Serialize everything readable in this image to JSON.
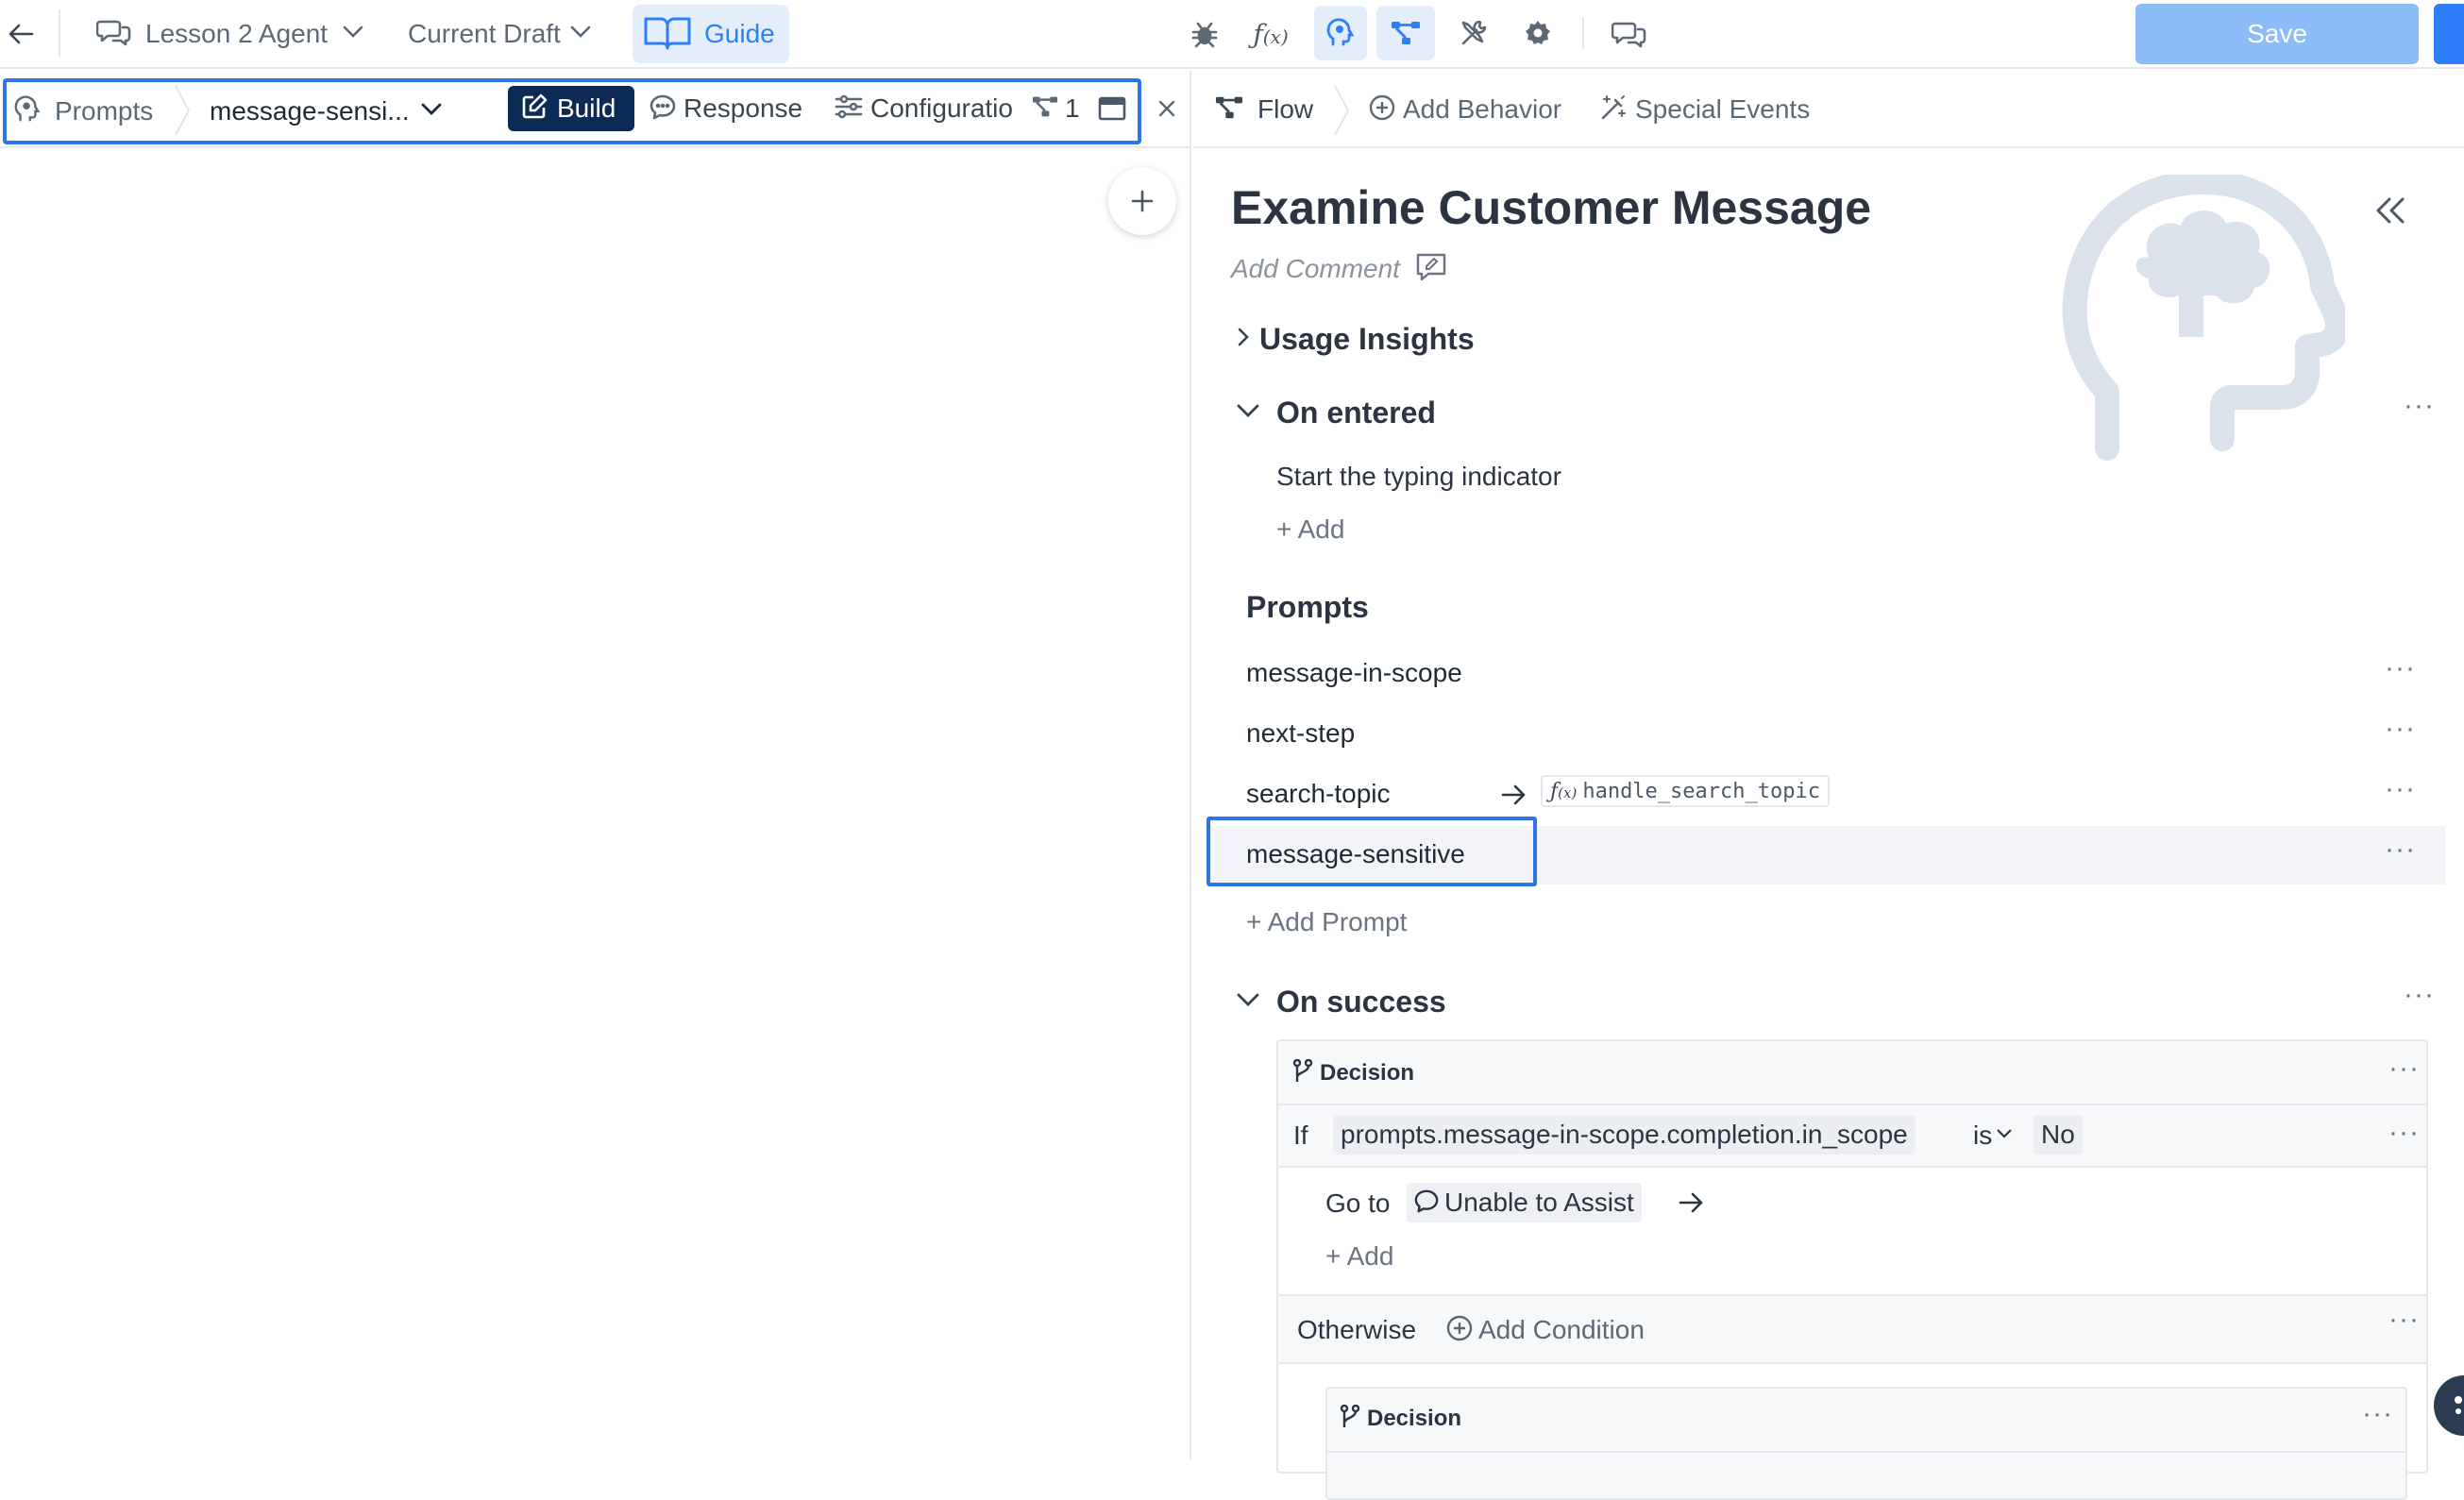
{
  "topbar": {
    "agent_name": "Lesson 2 Agent",
    "draft": "Current Draft",
    "guide": "Guide",
    "save": "Save"
  },
  "left_tabs": {
    "prompts": "Prompts",
    "prompt_name": "message-sensi...",
    "build": "Build",
    "response": "Response",
    "configuration": "Configuratio",
    "flow_count": "1"
  },
  "right_tabs": {
    "flow": "Flow",
    "add_behavior": "Add Behavior",
    "special_events": "Special Events"
  },
  "step": {
    "title": "Examine Customer Message",
    "add_comment": "Add Comment",
    "usage_insights": "Usage Insights",
    "on_entered": "On entered",
    "on_entered_action": "Start the typing indicator",
    "add": "+ Add",
    "prompts_heading": "Prompts",
    "prompts": [
      {
        "name": "message-in-scope"
      },
      {
        "name": "next-step"
      },
      {
        "name": "search-topic",
        "function": "handle_search_topic"
      },
      {
        "name": "message-sensitive"
      }
    ],
    "add_prompt": "+ Add Prompt",
    "on_success": "On success",
    "decision_label": "Decision",
    "if_label": "If",
    "condition_var": "prompts.message-in-scope.completion.in_scope",
    "operator": "is",
    "condition_value": "No",
    "goto_label": "Go to",
    "goto_target": "Unable to Assist",
    "add_inner": "+ Add",
    "otherwise": "Otherwise",
    "add_condition": "Add Condition",
    "decision_label_2": "Decision"
  },
  "colors": {
    "accent": "#2d7ff9",
    "build_bg": "#0b2a55",
    "save_bg": "#8cbcf8",
    "selection_outline": "#2f74e6"
  },
  "icons": [
    "back-arrow-icon",
    "chat-icon",
    "chevron-down-icon",
    "book-icon",
    "bug-icon",
    "function-icon",
    "brain-icon",
    "flow-icon",
    "tools-icon",
    "gear-icon",
    "comments-icon",
    "edit-icon",
    "sliders-icon",
    "panel-icon",
    "close-icon",
    "plus-icon",
    "collapse-icon",
    "comment-icon",
    "chevron-right-icon",
    "branch-icon",
    "arrow-right-icon"
  ]
}
